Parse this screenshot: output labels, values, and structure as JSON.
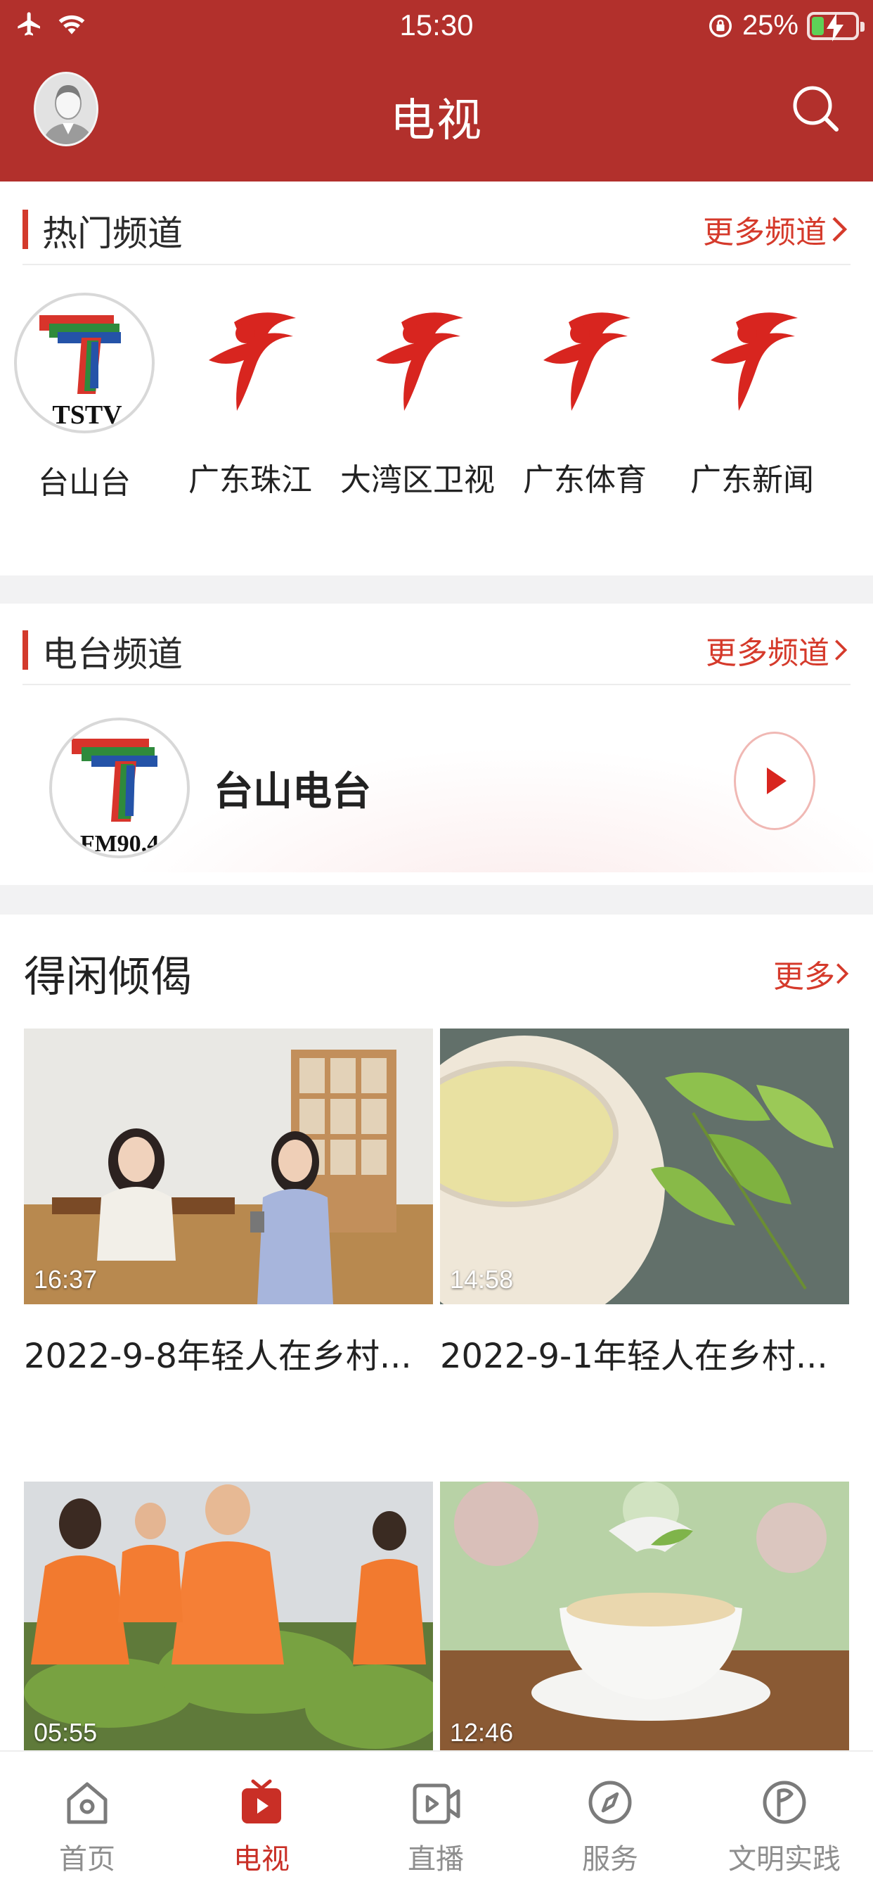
{
  "status_bar": {
    "time": "15:30",
    "battery_percent": "25%",
    "battery_level": 0.25
  },
  "header": {
    "title": "电视",
    "avatar_icon": "user-avatar-icon",
    "search_icon": "search-icon"
  },
  "hot_channels": {
    "title": "热门频道",
    "more_label": "更多频道",
    "items": [
      {
        "label": "台山台",
        "logo_text": "TSTV",
        "icon": "tstv-logo"
      },
      {
        "label": "广东珠江",
        "icon": "gdtv-logo"
      },
      {
        "label": "大湾区卫视",
        "icon": "gdtv-logo"
      },
      {
        "label": "广东体育",
        "icon": "gdtv-logo"
      },
      {
        "label": "广东新闻",
        "icon": "gdtv-logo"
      }
    ]
  },
  "radio_channels": {
    "title": "电台频道",
    "more_label": "更多频道",
    "item": {
      "name": "台山电台",
      "logo_text": "FM90.4",
      "icon": "tstv-logo"
    }
  },
  "videos": {
    "title": "得闲倾偈",
    "more_label": "更多",
    "items": [
      {
        "duration": "16:37",
        "title": "2022-9-8年轻人在乡村..."
      },
      {
        "duration": "14:58",
        "title": "2022-9-1年轻人在乡村..."
      },
      {
        "duration": "05:55",
        "title": ""
      },
      {
        "duration": "12:46",
        "title": ""
      }
    ]
  },
  "tabbar": {
    "items": [
      {
        "label": "首页",
        "icon": "home-icon"
      },
      {
        "label": "电视",
        "icon": "tv-icon",
        "active": true
      },
      {
        "label": "直播",
        "icon": "live-video-icon"
      },
      {
        "label": "服务",
        "icon": "compass-icon"
      },
      {
        "label": "文明实践",
        "icon": "flag-circle-icon"
      }
    ]
  },
  "colors": {
    "brand_red": "#b2302c",
    "accent_red": "#d53a2b",
    "inactive_gray": "#8e8e8e"
  }
}
